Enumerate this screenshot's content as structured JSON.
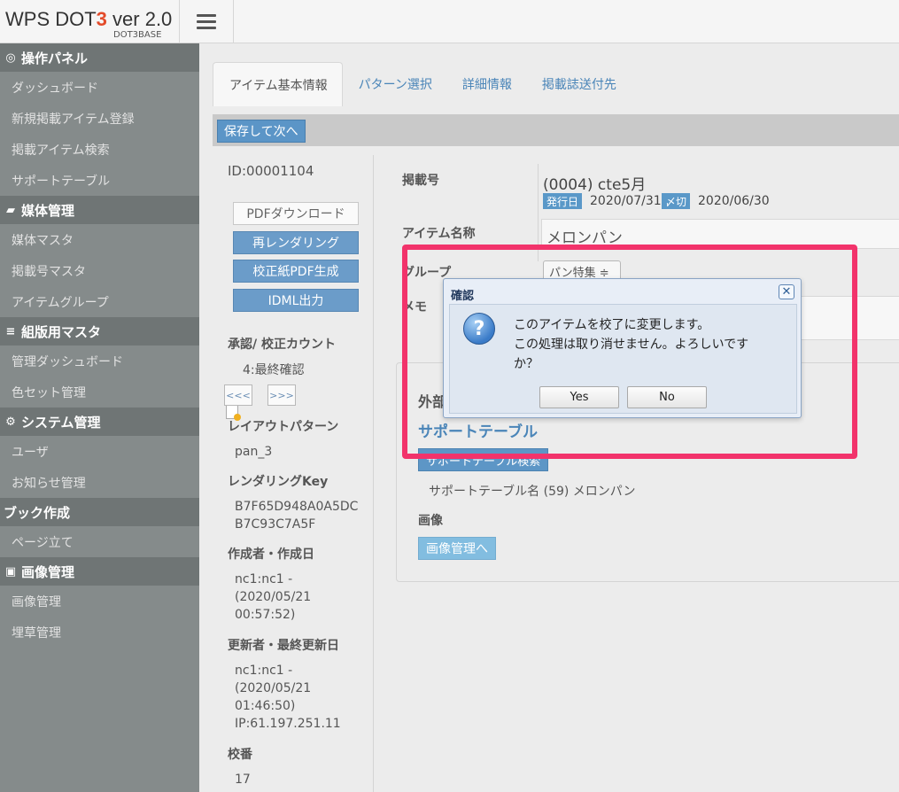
{
  "header": {
    "brand_prefix": "WPS DOT",
    "brand_num": "3",
    "brand_suffix": " ver 2.0",
    "brand_sub": "DOT3BASE"
  },
  "sidebar": {
    "sections": [
      {
        "title": "操作パネル",
        "icon": "dashboard-icon",
        "items": [
          "ダッシュボード",
          "新規掲載アイテム登録",
          "掲載アイテム検索",
          "サポートテーブル"
        ]
      },
      {
        "title": "媒体管理",
        "icon": "book-icon",
        "items": [
          "媒体マスタ",
          "掲載号マスタ",
          "アイテムグループ"
        ]
      },
      {
        "title": "組版用マスタ",
        "icon": "database-icon",
        "items": [
          "管理ダッシュボード",
          "色セット管理"
        ]
      },
      {
        "title": "システム管理",
        "icon": "gears-icon",
        "items": [
          "ユーザ",
          "お知らせ管理"
        ]
      },
      {
        "title": "ブック作成",
        "icon": "",
        "items": [
          "ページ立て"
        ]
      },
      {
        "title": "画像管理",
        "icon": "picture-icon",
        "items": [
          "画像管理",
          "埋草管理"
        ]
      }
    ]
  },
  "tabs": [
    "アイテム基本情報",
    "パターン選択",
    "詳細情報",
    "掲載誌送付先"
  ],
  "toolbar": {
    "save_next": "保存して次へ"
  },
  "left_panel": {
    "id_label": "ID:00001104",
    "btn_pdf_download": "PDFダウンロード",
    "btn_rerender": "再レンダリング",
    "btn_proof_pdf": "校正紙PDF生成",
    "btn_idml": "IDML出力",
    "approval_heading": "承認/ 校正カウント",
    "approval_status": "4:最終確認",
    "prev_btn": "<<<",
    "next_btn": ">>>",
    "layout_heading": "レイアウトパターン",
    "layout_value": "pan_3",
    "render_key_heading": "レンダリングKey",
    "render_key_line1": "B7F65D948A0A5DC",
    "render_key_line2": "B7C93C7A5F",
    "creator_heading": "作成者・作成日",
    "creator_line1": "nc1:nc1 -",
    "creator_line2": "(2020/05/21",
    "creator_line3": "00:57:52)",
    "updater_heading": "更新者・最終更新日",
    "updater_line1": "nc1:nc1 -",
    "updater_line2": "(2020/05/21",
    "updater_line3": "01:46:50)",
    "updater_line4": "IP:61.197.251.11",
    "edition_heading": "校番",
    "edition_value": "17"
  },
  "form": {
    "issue_label": "掲載号",
    "issue_value": "(0004) cte5月",
    "issue_date_badge": "発行日",
    "issue_date": "2020/07/31",
    "deadline_badge": "〆切",
    "deadline_date": "2020/06/30",
    "item_name_label": "アイテム名称",
    "item_name_value": "メロンパン",
    "group_label": "グループ",
    "group_value": "パン特集 ≑",
    "memo_label": "メモ",
    "external_label": "外部",
    "support_table_title": "サポートテーブル",
    "support_search_btn": "サポートテーブル検索",
    "support_table_name": "サポートテーブル名 (59) メロンパン",
    "image_label": "画像",
    "image_mgr_btn": "画像管理へ"
  },
  "dialog": {
    "title": "確認",
    "close": "✕",
    "line1": "このアイテムを校了に変更します。",
    "line2": "この処理は取り消せません。よろしいです",
    "line3": "か？",
    "yes": "Yes",
    "no": "No"
  },
  "colors": {
    "highlight": "#f2336b",
    "sidebar_bg": "#858b8b",
    "sidebar_section_bg": "#6f7575",
    "link_blue": "#4a85b8",
    "button_blue": "#6b9cc9"
  }
}
